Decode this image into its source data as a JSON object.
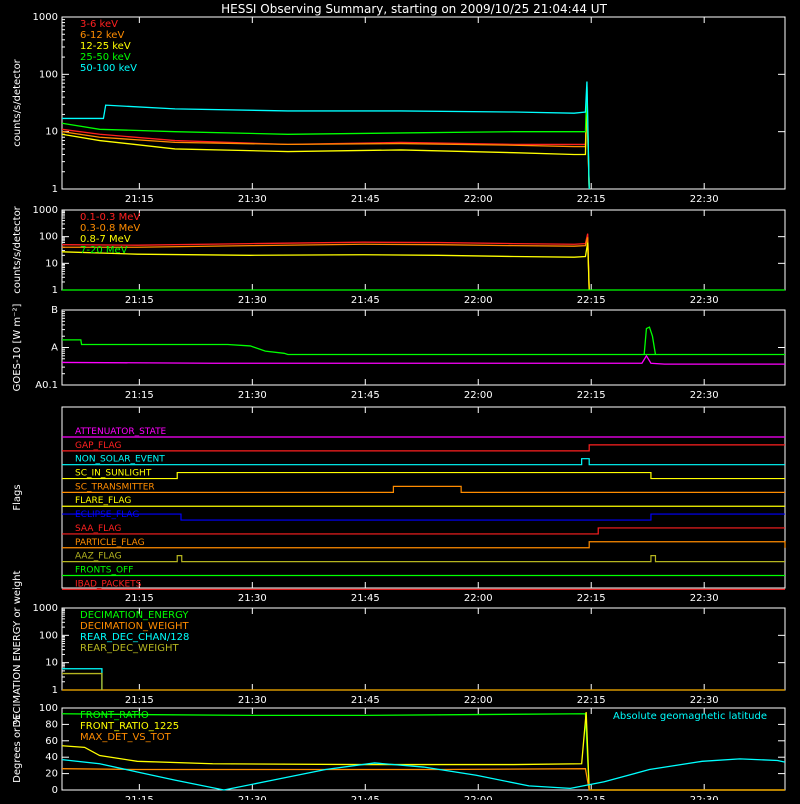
{
  "title": "HESSI Observing Summary, starting on 2009/10/25 21:04:44 UT",
  "time_ticks": [
    "21:15",
    "21:30",
    "21:45",
    "22:00",
    "22:15",
    "22:30"
  ],
  "time_tick_minutes": [
    10.27,
    25.27,
    40.27,
    55.27,
    70.27,
    85.27
  ],
  "time_span_minutes": 96,
  "colors": {
    "red": "#ff2020",
    "orange": "#ff8c00",
    "yellow": "#ffff00",
    "green": "#00ff00",
    "cyan": "#00ffff",
    "magenta": "#ff00ff",
    "blue": "#0000ff",
    "olive": "#b5b520",
    "axis": "#ffffff"
  },
  "chart_data": [
    {
      "id": "lightcurves",
      "type": "line",
      "ylabel": "counts/s/detector",
      "ylog": true,
      "ylim": [
        1,
        1000
      ],
      "y_ticks": [
        "1",
        "10",
        "100",
        "1000"
      ],
      "y_tick_values": [
        1,
        10,
        100,
        1000
      ],
      "series": [
        {
          "name": "3-6 keV",
          "color": "#ff2020",
          "x": [
            0,
            5,
            15,
            30,
            45,
            60,
            68,
            69.5,
            69.7,
            70
          ],
          "y": [
            11,
            9,
            7,
            6,
            6.5,
            6,
            6,
            6,
            25,
            1
          ]
        },
        {
          "name": "6-12 keV",
          "color": "#ff8c00",
          "x": [
            0,
            5,
            15,
            30,
            45,
            60,
            68,
            69.5,
            69.7,
            70
          ],
          "y": [
            10,
            8,
            6.5,
            6,
            6.2,
            5.8,
            5.5,
            5.5,
            30,
            1
          ]
        },
        {
          "name": "12-25 keV",
          "color": "#ffff00",
          "x": [
            0,
            5,
            15,
            30,
            45,
            60,
            68,
            69.5,
            69.7,
            70
          ],
          "y": [
            9,
            7,
            5,
            4.5,
            4.8,
            4.3,
            4,
            4,
            40,
            1
          ]
        },
        {
          "name": "25-50 keV",
          "color": "#00ff00",
          "x": [
            0,
            5,
            15,
            30,
            45,
            60,
            68,
            69.5,
            69.7,
            70
          ],
          "y": [
            14,
            11,
            10,
            9,
            9.5,
            10,
            10,
            10,
            60,
            1
          ]
        },
        {
          "name": "50-100 keV",
          "color": "#00ffff",
          "x": [
            0,
            5.5,
            5.8,
            15,
            30,
            45,
            60,
            68,
            69.5,
            69.7,
            70
          ],
          "y": [
            17,
            17,
            29,
            25,
            23,
            23,
            22,
            21,
            22,
            75,
            1
          ]
        }
      ]
    },
    {
      "id": "highenergy",
      "type": "line",
      "ylabel": "counts/s/detector",
      "ylog": true,
      "ylim": [
        1,
        1000
      ],
      "y_ticks": [
        "1",
        "10",
        "100",
        "1000"
      ],
      "y_tick_values": [
        1,
        10,
        100,
        1000
      ],
      "series": [
        {
          "name": "0.1-0.3 MeV",
          "color": "#ff2020",
          "x": [
            0,
            10,
            25,
            40,
            50,
            60,
            68,
            69.5,
            69.8,
            70
          ],
          "y": [
            50,
            48,
            55,
            62,
            60,
            55,
            52,
            55,
            130,
            1
          ]
        },
        {
          "name": "0.3-0.8 MeV",
          "color": "#ff8c00",
          "x": [
            0,
            10,
            25,
            40,
            50,
            60,
            68,
            69.5,
            69.8,
            70
          ],
          "y": [
            40,
            40,
            46,
            52,
            50,
            46,
            44,
            46,
            95,
            1
          ]
        },
        {
          "name": "0.8-7 MeV",
          "color": "#ffff00",
          "x": [
            0,
            10,
            25,
            40,
            50,
            60,
            68,
            69.5,
            69.8,
            70
          ],
          "y": [
            27,
            22,
            20,
            21,
            20,
            18,
            17,
            18,
            60,
            1
          ]
        },
        {
          "name": "7-20 MeV",
          "color": "#00ff00",
          "x": [
            0,
            96
          ],
          "y": [
            1,
            1
          ]
        }
      ]
    },
    {
      "id": "goes",
      "type": "line",
      "ylabel": "GOES-10 [W m⁻²]",
      "ylog": true,
      "ylim": [
        1e-09,
        1e-07
      ],
      "y_ticks": [
        "A0.1",
        "A",
        "B"
      ],
      "y_tick_values": [
        1e-09,
        1e-08,
        1e-07
      ],
      "series": [
        {
          "color": "#00ff00",
          "x": [
            0,
            2.5,
            2.6,
            22,
            25,
            27,
            29.5,
            30,
            96
          ],
          "y": [
            1.6e-08,
            1.6e-08,
            1.2e-08,
            1.2e-08,
            1.1e-08,
            8e-09,
            7e-09,
            6.5e-09,
            6.5e-09
          ]
        },
        {
          "color": "#00ff00",
          "x": [
            77.3,
            77.6,
            78,
            78.4,
            78.8
          ],
          "y": [
            6.5e-09,
            3.2e-08,
            3.5e-08,
            2e-08,
            6.5e-09
          ]
        },
        {
          "color": "#ff00ff",
          "x": [
            0,
            20,
            40,
            60,
            77,
            77.6,
            78.2,
            80,
            96
          ],
          "y": [
            4e-09,
            3.8e-09,
            3.8e-09,
            3.8e-09,
            3.8e-09,
            6e-09,
            3.8e-09,
            3.6e-09,
            3.6e-09
          ]
        }
      ]
    },
    {
      "id": "flags",
      "type": "line",
      "ylabel": "Flags",
      "flags": [
        {
          "name": "ATTENUATOR_STATE",
          "color": "#ff00ff",
          "segments": [
            [
              0,
              96,
              0
            ]
          ]
        },
        {
          "name": "GAP_FLAG",
          "color": "#ff2020",
          "segments": [
            [
              0,
              70,
              0
            ],
            [
              70,
              96,
              1
            ]
          ]
        },
        {
          "name": "NON_SOLAR_EVENT",
          "color": "#00ffff",
          "segments": [
            [
              0,
              69,
              0
            ],
            [
              69,
              70,
              1
            ],
            [
              70,
              96,
              0
            ]
          ]
        },
        {
          "name": "SC_IN_SUNLIGHT",
          "color": "#ffff00",
          "segments": [
            [
              0,
              15.3,
              0
            ],
            [
              15.3,
              78.2,
              1
            ],
            [
              78.2,
              96,
              0
            ]
          ]
        },
        {
          "name": "SC_TRANSMITTER",
          "color": "#ff8c00",
          "segments": [
            [
              0,
              44,
              0
            ],
            [
              44,
              53,
              1
            ],
            [
              53,
              96,
              0
            ]
          ]
        },
        {
          "name": "FLARE_FLAG",
          "color": "#ffff00",
          "segments": [
            [
              0,
              96,
              0
            ]
          ]
        },
        {
          "name": "ECLIPSE_FLAG",
          "color": "#0000ff",
          "segments": [
            [
              0,
              15.8,
              1
            ],
            [
              15.8,
              78.2,
              0
            ],
            [
              78.2,
              96,
              1
            ]
          ]
        },
        {
          "name": "SAA_FLAG",
          "color": "#ff2020",
          "segments": [
            [
              0,
              71.2,
              0
            ],
            [
              71.2,
              96,
              1
            ]
          ]
        },
        {
          "name": "PARTICLE_FLAG",
          "color": "#ff8c00",
          "segments": [
            [
              0,
              70,
              0
            ],
            [
              70,
              96,
              1
            ],
            [
              96,
              96,
              0
            ]
          ]
        },
        {
          "name": "AAZ_FLAG",
          "color": "#b5b520",
          "segments": [
            [
              0,
              15.3,
              0
            ],
            [
              15.3,
              15.9,
              1
            ],
            [
              15.9,
              78.2,
              0
            ],
            [
              78.2,
              78.8,
              1
            ],
            [
              78.8,
              96,
              0
            ]
          ]
        },
        {
          "name": "FRONTS_OFF",
          "color": "#00ff00",
          "segments": [
            [
              0,
              96,
              0
            ]
          ]
        },
        {
          "name": "IBAD_PACKETS",
          "color": "#ff2020",
          "segments": [
            [
              0,
              96,
              0
            ]
          ]
        }
      ]
    },
    {
      "id": "decimation",
      "type": "line",
      "ylabel": "DECIMATION ENERGY or weight",
      "ylog": true,
      "ylim": [
        1,
        1000
      ],
      "y_ticks": [
        "1",
        "10",
        "100",
        "1000"
      ],
      "y_tick_values": [
        1,
        10,
        100,
        1000
      ],
      "series": [
        {
          "name": "DECIMATION_ENERGY",
          "color": "#00ff00",
          "x": [
            0,
            96
          ],
          "y": [
            1,
            1
          ]
        },
        {
          "name": "DECIMATION_WEIGHT",
          "color": "#ff8c00",
          "x": [
            0,
            96
          ],
          "y": [
            1,
            1
          ]
        },
        {
          "name": "REAR_DEC_CHAN/128",
          "color": "#00ffff",
          "x": [
            0,
            5.3,
            5.3
          ],
          "y": [
            6,
            6,
            1
          ]
        },
        {
          "name": "REAR_DEC_WEIGHT",
          "color": "#b5b520",
          "x": [
            0,
            5.3,
            5.3
          ],
          "y": [
            4,
            4,
            1
          ]
        }
      ]
    },
    {
      "id": "ratios",
      "type": "line",
      "ylabel": "Degrees or %",
      "ylim": [
        0,
        100
      ],
      "y_ticks": [
        "0",
        "20",
        "40",
        "60",
        "80",
        "100"
      ],
      "y_tick_values": [
        0,
        20,
        40,
        60,
        80,
        100
      ],
      "annotation": "Absolute geomagnetic latitude",
      "series": [
        {
          "name": "FRONT_RATIO",
          "color": "#00ff00",
          "x": [
            0,
            10,
            25,
            40,
            55,
            69.5,
            70,
            96
          ],
          "y": [
            93,
            92,
            91,
            91,
            92,
            93,
            0,
            0
          ]
        },
        {
          "name": "FRONT_RATIO_1225",
          "color": "#ffff00",
          "x": [
            0,
            3,
            5,
            10,
            20,
            40,
            60,
            69,
            69.6,
            70,
            96
          ],
          "y": [
            54,
            52,
            42,
            35,
            32,
            31,
            31,
            32,
            95,
            0,
            0
          ]
        },
        {
          "name": "MAX_DET_VS_TOT",
          "color": "#ff8c00",
          "x": [
            0,
            10,
            30,
            50,
            69.5,
            70,
            96
          ],
          "y": [
            26,
            25,
            25,
            25,
            26,
            0,
            0
          ]
        },
        {
          "color": "#00ffff",
          "x": [
            0,
            5,
            10,
            15,
            21.5,
            28,
            35,
            41.5,
            48,
            55,
            62,
            67.5,
            72,
            78,
            85,
            90,
            95,
            96
          ],
          "y": [
            37,
            32,
            22,
            12,
            0,
            12,
            25,
            33,
            28,
            18,
            5,
            2,
            10,
            25,
            35,
            38,
            36,
            34
          ]
        }
      ]
    }
  ]
}
